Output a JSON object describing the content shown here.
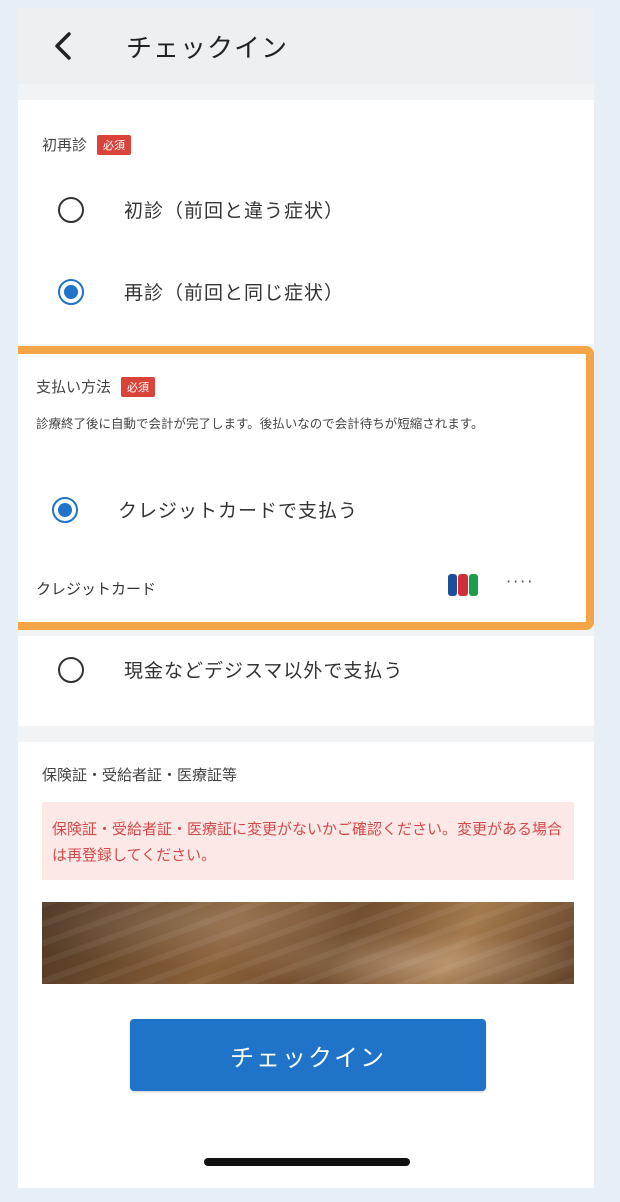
{
  "header": {
    "title": "チェックイン"
  },
  "visit_type": {
    "label": "初再診",
    "required": "必須",
    "options": [
      {
        "label": "初診（前回と違う症状）",
        "selected": false
      },
      {
        "label": "再診（前回と同じ症状）",
        "selected": true
      }
    ]
  },
  "payment": {
    "label": "支払い方法",
    "required": "必須",
    "description": "診療終了後に自動で会計が完了します。後払いなので会計待ちが短縮されます。",
    "options": [
      {
        "label": "クレジットカードで支払う",
        "selected": true
      },
      {
        "label": "現金などデジスマ以外で支払う",
        "selected": false
      }
    ],
    "card": {
      "label": "クレジットカード",
      "brand_icon": "jcb-icon",
      "masked": "····"
    }
  },
  "insurance": {
    "label": "保険証・受給者証・医療証等",
    "warning": "保険証・受給者証・医療証に変更がないかご確認ください。変更がある場合は再登録してください。"
  },
  "footer": {
    "checkin_button": "チェックイン"
  },
  "colors": {
    "accent": "#1f73c9",
    "highlight": "#f2a446",
    "required": "#d9433a",
    "warning_text": "#d44a4a",
    "warning_bg": "#fde8e8"
  }
}
